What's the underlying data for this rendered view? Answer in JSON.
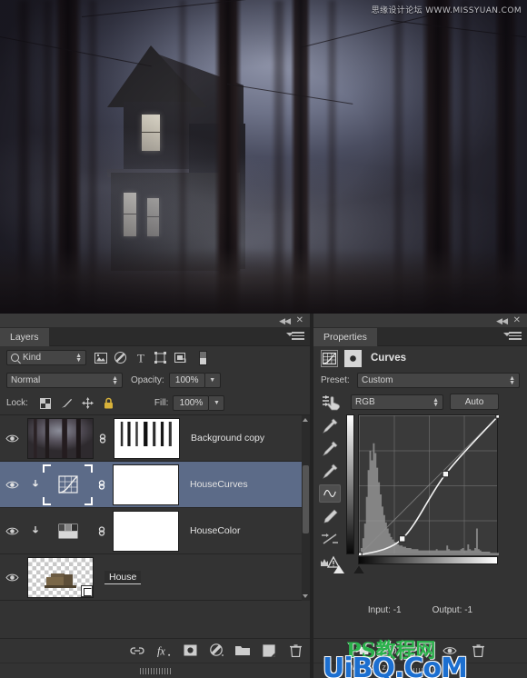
{
  "canvas": {
    "watermark_top": "思缘设计论坛 WWW.MISSYUAN.COM",
    "scene_description": "Dark foggy forest with haunted house"
  },
  "layers_panel": {
    "tab_label": "Layers",
    "collapse_icon": "collapse-icon",
    "close_icon": "close-icon",
    "menu_icon": "panel-menu-icon",
    "filter": {
      "kind_label": "Kind",
      "search_icon": "search-icon",
      "icons": [
        "image-filter-icon",
        "adjustment-filter-icon",
        "type-filter-icon",
        "shape-filter-icon",
        "smart-object-filter-icon"
      ],
      "toggle_name": "filter-toggle-switch"
    },
    "blend_mode": "Normal",
    "opacity_label": "Opacity:",
    "opacity_value": "100%",
    "lock_label": "Lock:",
    "lock_icons": [
      "lock-transparent-icon",
      "lock-image-icon",
      "lock-position-icon",
      "lock-all-icon"
    ],
    "fill_label": "Fill:",
    "fill_value": "100%",
    "layers": [
      {
        "name": "Background copy",
        "visible": true,
        "selected": false,
        "thumb_type": "forest",
        "has_mask": true,
        "mask_type": "maskpaint",
        "linked": true,
        "clipped": false
      },
      {
        "name": "HouseCurves",
        "visible": true,
        "selected": true,
        "thumb_type": "curves-adjustment",
        "has_mask": true,
        "mask_type": "white",
        "linked": true,
        "clipped": true
      },
      {
        "name": "HouseColor",
        "visible": true,
        "selected": false,
        "thumb_type": "color-balance-adjustment",
        "has_mask": true,
        "mask_type": "white",
        "linked": true,
        "clipped": true
      },
      {
        "name": "House",
        "visible": true,
        "selected": false,
        "thumb_type": "alpha-house",
        "has_mask": false,
        "mask_type": "",
        "linked": false,
        "clipped": false,
        "name_editing": true
      }
    ],
    "footer_buttons": [
      "link-layers-icon",
      "layer-style-fx-icon",
      "add-mask-icon",
      "new-adjustment-layer-icon",
      "new-group-icon",
      "new-layer-icon",
      "delete-layer-icon"
    ]
  },
  "properties_panel": {
    "tab_label": "Properties",
    "collapse_icon": "collapse-icon",
    "close_icon": "close-icon",
    "menu_icon": "panel-menu-icon",
    "title": "Curves",
    "header_icons": [
      "curves-adjustment-icon",
      "mask-properties-icon"
    ],
    "preset_label": "Preset:",
    "preset_value": "Custom",
    "channel_value": "RGB",
    "auto_label": "Auto",
    "on_image_icon": "on-image-adjust-icon",
    "tools": [
      "black-point-eyedropper-icon",
      "gray-point-eyedropper-icon",
      "white-point-eyedropper-icon",
      "curve-edit-icon",
      "pencil-draw-icon",
      "smooth-curve-icon",
      "clipping-warning-icon"
    ],
    "selected_tool": "curve-edit-icon",
    "input_label": "Input:",
    "input_value": "-1",
    "output_label": "Output:",
    "output_value": "-1",
    "footer_buttons": [
      "clip-to-layer-icon",
      "view-previous-state-icon",
      "reset-icon",
      "toggle-visibility-icon",
      "delete-adjustment-icon"
    ]
  },
  "chart_data": {
    "type": "line",
    "title": "Curves",
    "xlabel": "Input",
    "ylabel": "Output",
    "xlim": [
      0,
      255
    ],
    "ylim": [
      0,
      255
    ],
    "grid": true,
    "legend": "none",
    "series": [
      {
        "name": "RGB Curve",
        "points": [
          {
            "x": 0,
            "y": 0
          },
          {
            "x": 79,
            "y": 30
          },
          {
            "x": 158,
            "y": 148
          },
          {
            "x": 255,
            "y": 255
          }
        ]
      },
      {
        "name": "Baseline Diagonal",
        "points": [
          {
            "x": 0,
            "y": 0
          },
          {
            "x": 255,
            "y": 255
          }
        ]
      }
    ],
    "histogram": {
      "name": "Input Histogram",
      "bins": [
        2,
        6,
        14,
        26,
        48,
        70,
        86,
        78,
        92,
        84,
        72,
        60,
        50,
        40,
        33,
        27,
        22,
        18,
        15,
        13,
        11,
        10,
        9,
        8,
        8,
        7,
        7,
        6,
        6,
        6,
        5,
        5,
        5,
        5,
        4,
        4,
        4,
        4,
        4,
        4,
        4,
        4,
        4,
        4,
        5,
        4,
        4,
        4,
        4,
        4,
        8,
        5,
        4,
        4,
        4,
        4,
        4,
        4,
        5,
        6,
        4,
        4,
        9,
        5,
        4,
        4,
        6,
        22,
        5,
        4,
        3,
        3,
        3,
        3,
        3,
        2,
        2,
        2,
        2,
        2
      ]
    },
    "black_point_slider": 0,
    "white_point_slider": 255
  }
}
